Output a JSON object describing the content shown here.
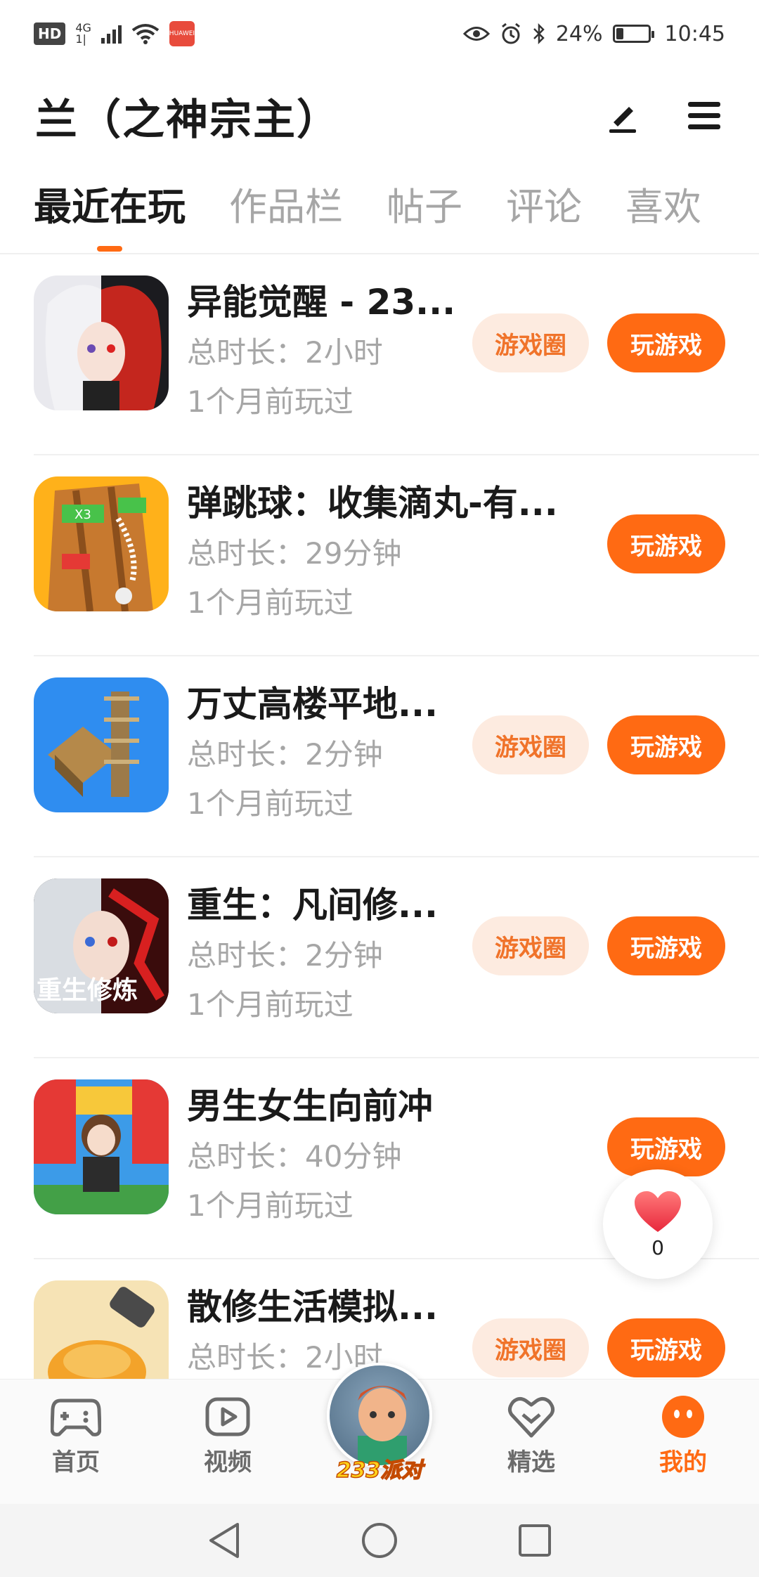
{
  "status_bar": {
    "left": {
      "hd": "HD",
      "network": "4G",
      "network_sub": "1|",
      "app_badge": "HUAWEI"
    },
    "right": {
      "battery": "24%",
      "time": "10:45"
    }
  },
  "header": {
    "title": "兰（之神宗主）"
  },
  "tabs": [
    "最近在玩",
    "作品栏",
    "帖子",
    "评论",
    "喜欢"
  ],
  "games": [
    {
      "name": "异能觉醒 - 23...",
      "duration": "总时长：2小时",
      "last_played": "1个月前玩过",
      "circle_label": "游戏圈",
      "play_label": "玩游戏",
      "has_circle": true
    },
    {
      "name": "弹跳球：收集滴丸-有...",
      "duration": "总时长：29分钟",
      "last_played": "1个月前玩过",
      "circle_label": "",
      "play_label": "玩游戏",
      "has_circle": false
    },
    {
      "name": "万丈高楼平地...",
      "duration": "总时长：2分钟",
      "last_played": "1个月前玩过",
      "circle_label": "游戏圈",
      "play_label": "玩游戏",
      "has_circle": true
    },
    {
      "name": "重生：凡间修...",
      "duration": "总时长：2分钟",
      "last_played": "1个月前玩过",
      "circle_label": "游戏圈",
      "play_label": "玩游戏",
      "has_circle": true,
      "icon_text": "重生修炼"
    },
    {
      "name": "男生女生向前冲",
      "duration": "总时长：40分钟",
      "last_played": "1个月前玩过",
      "circle_label": "",
      "play_label": "玩游戏",
      "has_circle": false
    },
    {
      "name": "散修生活模拟...",
      "duration": "总时长：2小时",
      "last_played": "",
      "circle_label": "游戏圈",
      "play_label": "玩游戏",
      "has_circle": true
    }
  ],
  "floating_like": {
    "count": "0"
  },
  "bottom_nav": {
    "items": [
      {
        "label": "首页"
      },
      {
        "label": "视频"
      },
      {
        "label": "233派对"
      },
      {
        "label": "精选"
      },
      {
        "label": "我的"
      }
    ],
    "active": "我的"
  },
  "colors": {
    "accent": "#ff6a13",
    "accent_light": "#fdebe0",
    "muted_text": "#a6a6a6"
  }
}
